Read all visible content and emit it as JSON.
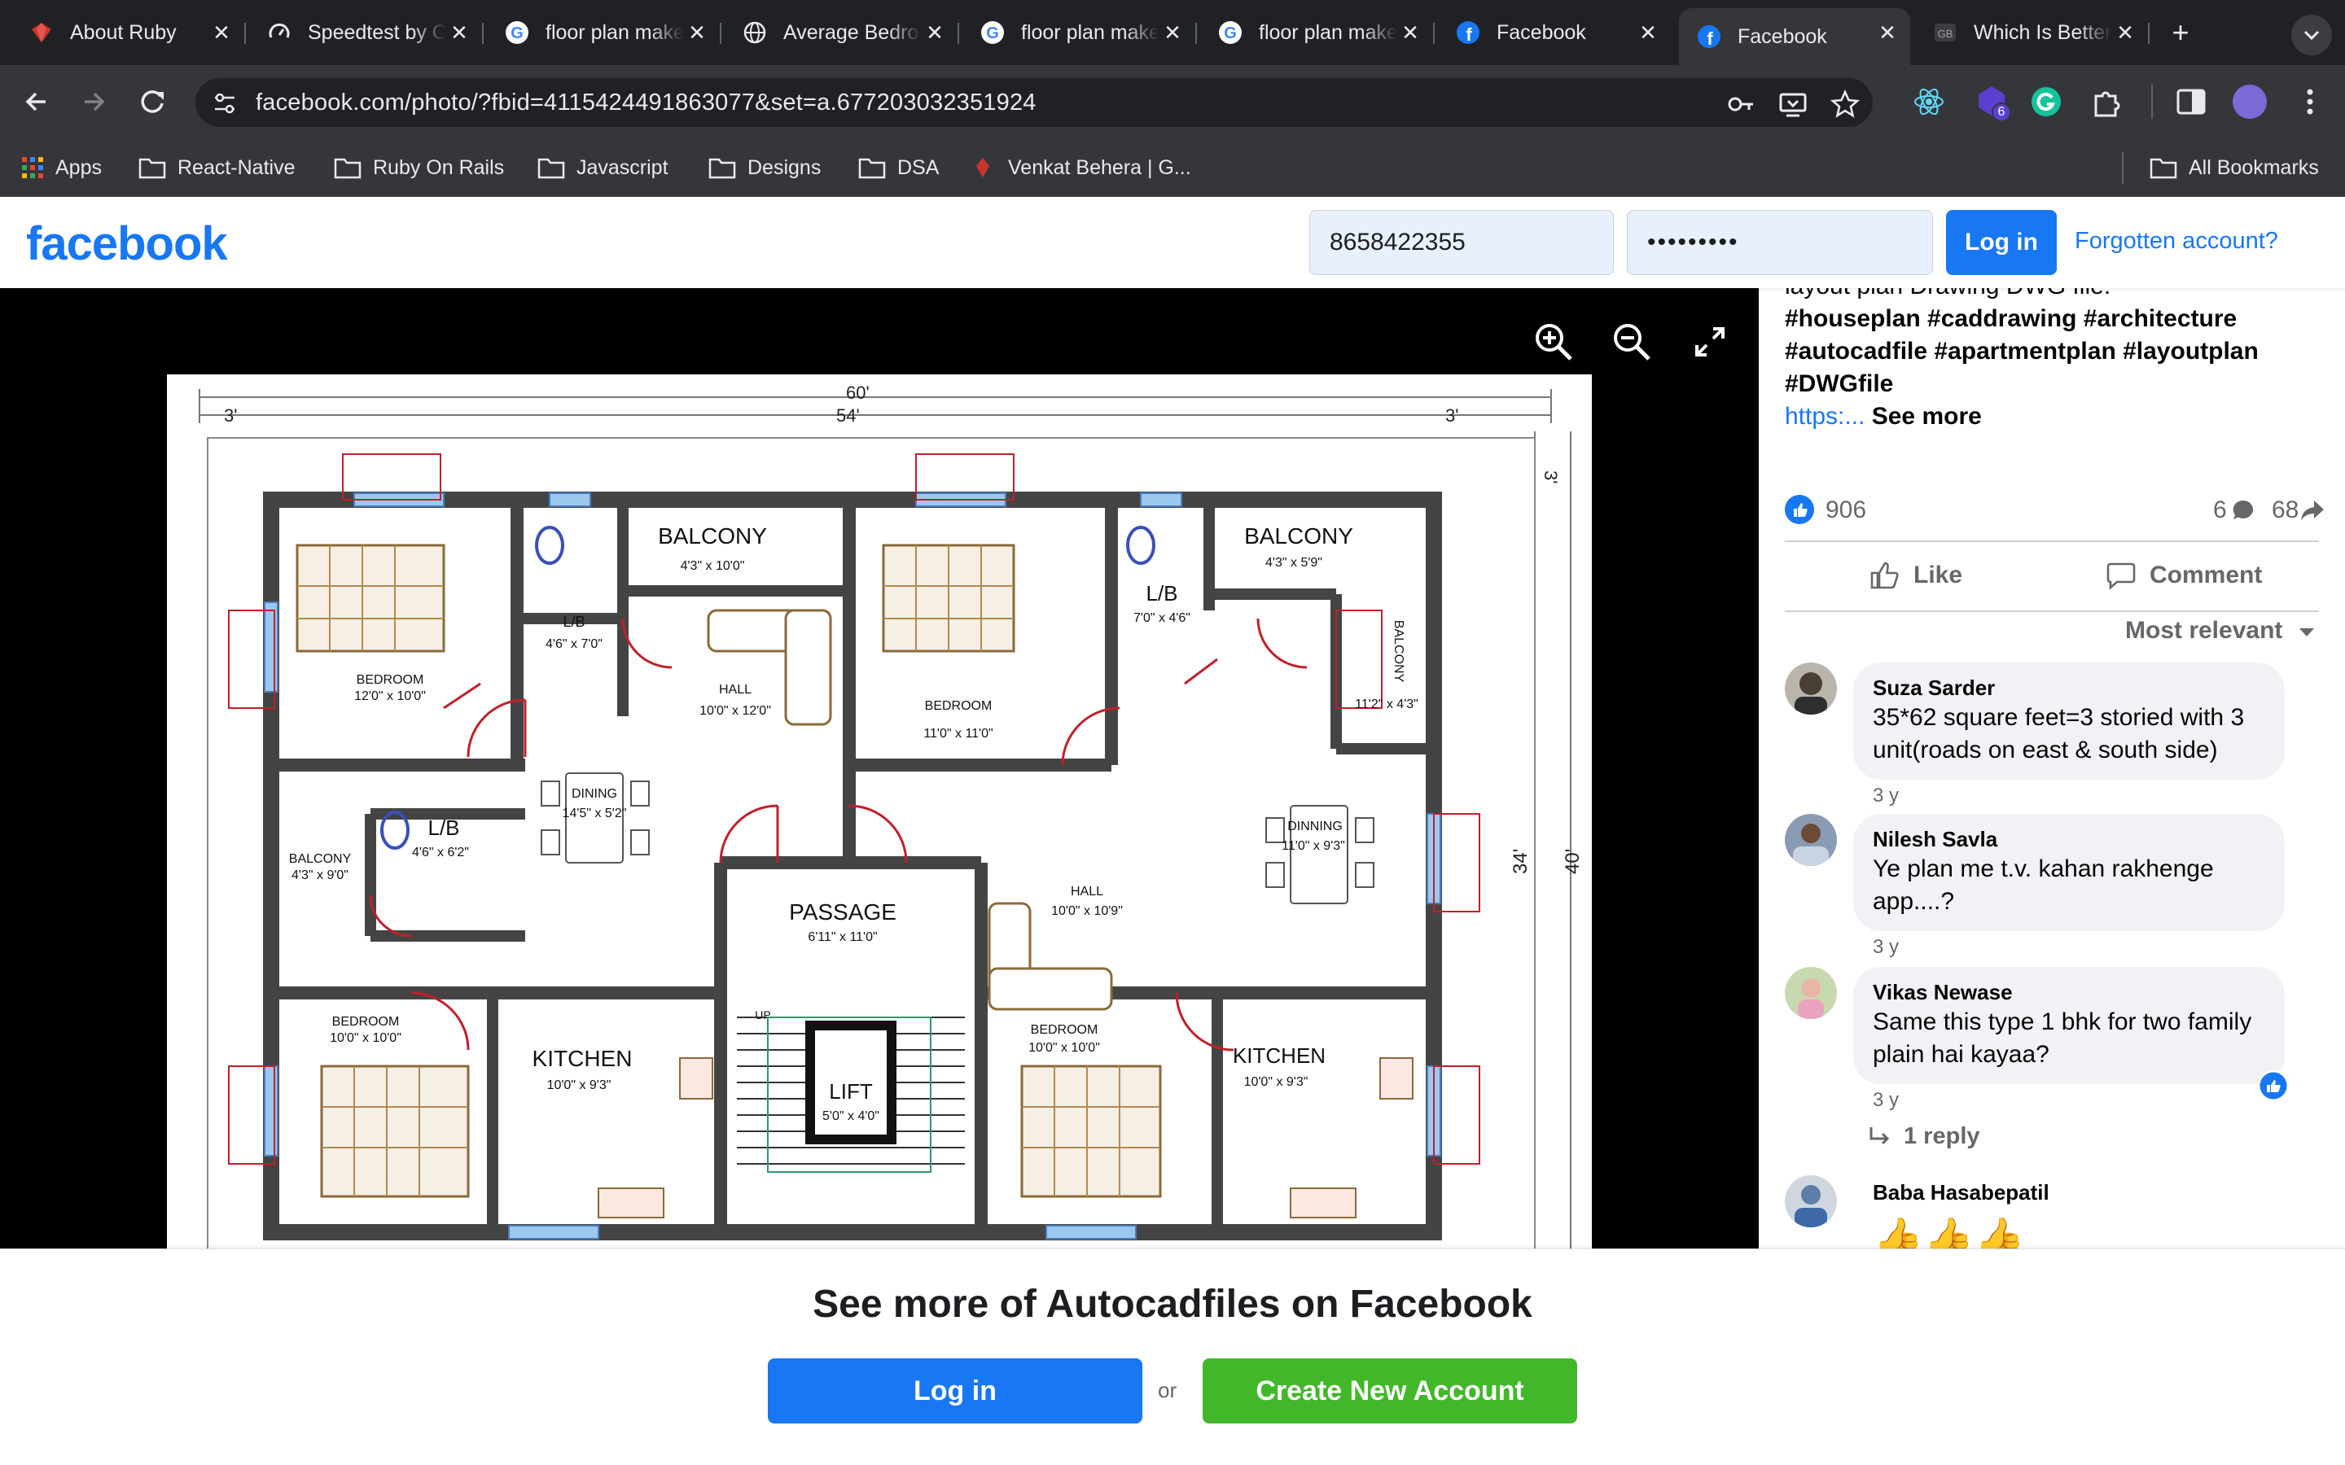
{
  "browser": {
    "tabs": [
      {
        "title": "About Ruby",
        "icon": "ruby-icon",
        "active": false
      },
      {
        "title": "Speedtest by Ookla",
        "icon": "speedtest-icon",
        "active": false
      },
      {
        "title": "floor plan maker",
        "icon": "google-icon",
        "active": false
      },
      {
        "title": "Average Bedroom",
        "icon": "globe-icon",
        "active": false
      },
      {
        "title": "floor plan maker",
        "icon": "google-icon",
        "active": false
      },
      {
        "title": "floor plan maker",
        "icon": "google-icon",
        "active": false
      },
      {
        "title": "Facebook",
        "icon": "facebook-icon",
        "active": false
      },
      {
        "title": "Facebook",
        "icon": "facebook-icon",
        "active": true
      },
      {
        "title": "Which Is Better",
        "icon": "site-icon",
        "active": false
      }
    ],
    "url": "facebook.com/photo/?fbid=4115424491863077&set=a.677203032351924",
    "extension_badge": "6",
    "bookmarks": [
      {
        "label": "Apps",
        "icon": "apps-grid-icon"
      },
      {
        "label": "React-Native",
        "icon": "folder-icon"
      },
      {
        "label": "Ruby On Rails",
        "icon": "folder-icon"
      },
      {
        "label": "Javascript",
        "icon": "folder-icon"
      },
      {
        "label": "Designs",
        "icon": "folder-icon"
      },
      {
        "label": "DSA",
        "icon": "folder-icon"
      },
      {
        "label": "Venkat Behera | G...",
        "icon": "ruby-icon"
      }
    ],
    "all_bookmarks": "All Bookmarks"
  },
  "fb_header": {
    "logo": "facebook",
    "phone_value": "8658422355",
    "password_value": "•••••••••",
    "login_label": "Log in",
    "forgot_label": "Forgotten account?"
  },
  "viewer": {
    "plan": {
      "dim_top": "60'",
      "dim_top2": "54'",
      "dim_side3_left": "3'",
      "dim_side3_right": "3'",
      "dim_right_3": "3'",
      "dim_right_34": "34'",
      "dim_right_40": "40'",
      "rooms": [
        {
          "name": "BALCONY",
          "size": "4'3\" x 10'0\""
        },
        {
          "name": "L/B",
          "size": "4'6\" x 7'0\""
        },
        {
          "name": "BEDROOM",
          "size": "12'0\" x 10'0\""
        },
        {
          "name": "HALL",
          "size": "10'0\" x 12'0\""
        },
        {
          "name": "DINING",
          "size": "14'5\" x 5'2\""
        },
        {
          "name": "L/B",
          "size": "4'6\" x 6'2\""
        },
        {
          "name": "BALCONY",
          "size": "4'3\" x 9'0\""
        },
        {
          "name": "BEDROOM",
          "size": "10'0\" x 10'0\""
        },
        {
          "name": "KITCHEN",
          "size": "10'0\" x 9'3\""
        },
        {
          "name": "PASSAGE",
          "size": "6'11\" x 11'0\""
        },
        {
          "name": "LIFT",
          "size": "5'0\" x 4'0\""
        },
        {
          "name": "UP",
          "size": ""
        },
        {
          "name": "BALCONY",
          "size": "4'3\" x 5'9\""
        },
        {
          "name": "L/B",
          "size": "7'0\" x 4'6\""
        },
        {
          "name": "BEDROOM",
          "size": "11'0\" x 11'0\""
        },
        {
          "name": "BALCONY",
          "size": "11'2\" x 4'3\""
        },
        {
          "name": "DINNING",
          "size": "11'0\" x 9'3\""
        },
        {
          "name": "HALL",
          "size": "10'0\" x 10'9\""
        },
        {
          "name": "BEDROOM",
          "size": "10'0\" x 10'0\""
        },
        {
          "name": "KITCHEN",
          "size": "10'0\" x 9'3\""
        }
      ]
    }
  },
  "post": {
    "desc_top": "layout plan Drawing DWG file.",
    "hashtags": "#houseplan #caddrawing #architecture #autocadfile #apartmentplan #layoutplan #DWGfile",
    "link": "https:...",
    "see_more": "See more",
    "reactions": "906",
    "comments_count": "6",
    "shares_count": "68",
    "like_label": "Like",
    "comment_label": "Comment",
    "sort_label": "Most relevant"
  },
  "comments": [
    {
      "name": "Suza Sarder",
      "text": "35*62 square feet=3 storied with 3 unit(roads on east & south side)",
      "time": "3 y"
    },
    {
      "name": "Nilesh Savla",
      "text": "Ye plan me t.v. kahan rakhenge app....?",
      "time": "3 y"
    },
    {
      "name": "Vikas Newase",
      "text": "Same this type 1 bhk for two family plain hai kayaa?",
      "time": "3 y"
    },
    {
      "name": "Baba Hasabepatil",
      "text": "👍👍👍",
      "time": ""
    }
  ],
  "reply_label": "1 reply",
  "banner": {
    "title": "See more of Autocadfiles on Facebook",
    "login": "Log in",
    "or": "or",
    "create": "Create New Account"
  },
  "colors": {
    "fb_blue": "#1877f2",
    "create_green": "#42b72a",
    "chrome_dark": "#202124",
    "chrome_toolbar": "#35363a"
  }
}
